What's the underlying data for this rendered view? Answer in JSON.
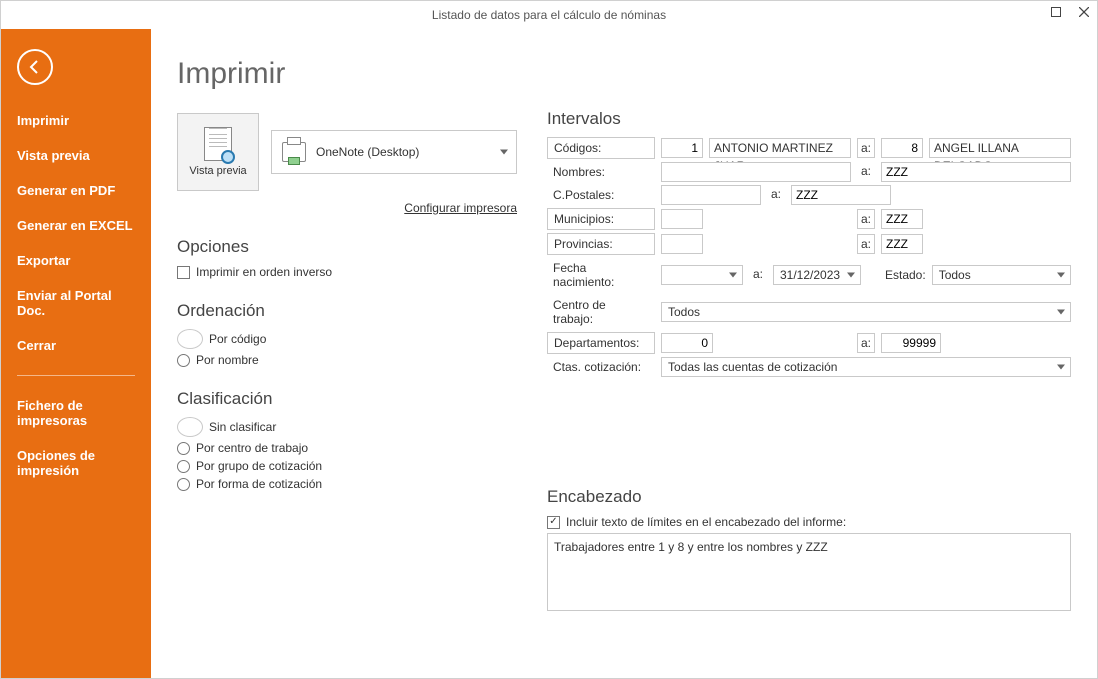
{
  "window": {
    "title": "Listado de datos para el cálculo de nóminas"
  },
  "sidebar": {
    "items": [
      "Imprimir",
      "Vista previa",
      "Generar en PDF",
      "Generar en EXCEL",
      "Exportar",
      "Enviar al Portal Doc.",
      "Cerrar"
    ],
    "items2": [
      "Fichero de impresoras",
      "Opciones de impresión"
    ]
  },
  "page": {
    "title": "Imprimir",
    "preview_label": "Vista previa",
    "printer_name": "OneNote (Desktop)",
    "config_printer": "Configurar impresora"
  },
  "opciones": {
    "section": "Opciones",
    "reverse": "Imprimir en orden inverso"
  },
  "ordenacion": {
    "section": "Ordenación",
    "por_codigo": "Por código",
    "por_nombre": "Por nombre"
  },
  "clasificacion": {
    "section": "Clasificación",
    "sin": "Sin clasificar",
    "centro": "Por centro de trabajo",
    "grupo": "Por grupo de cotización",
    "forma": "Por forma de cotización"
  },
  "intervalos": {
    "section": "Intervalos",
    "a": "a:",
    "codigos_label": "Códigos:",
    "codigos_from": "1",
    "codigos_from_name": "ANTONIO MARTINEZ JUAR",
    "codigos_to": "8",
    "codigos_to_name": "ANGEL ILLANA DELGADO",
    "nombres_label": "Nombres:",
    "nombres_from": "",
    "nombres_to": "ZZZ",
    "cpostales_label": "C.Postales:",
    "cpostales_from": "",
    "cpostales_to": "ZZZ",
    "municipios_label": "Municipios:",
    "municipios_from": "",
    "municipios_to": "ZZZ",
    "provincias_label": "Provincias:",
    "provincias_from": "",
    "provincias_to": "ZZZ",
    "fecha_label": "Fecha nacimiento:",
    "fecha_from": "",
    "fecha_to": "31/12/2023",
    "estado_label": "Estado:",
    "estado_value": "Todos",
    "centro_label": "Centro de trabajo:",
    "centro_value": "Todos",
    "dept_label": "Departamentos:",
    "dept_from": "0",
    "dept_to": "99999",
    "ctas_label": "Ctas. cotización:",
    "ctas_value": "Todas las cuentas de cotización"
  },
  "encabezado": {
    "section": "Encabezado",
    "chk_label": "Incluir texto de límites en el encabezado del informe:",
    "text": "Trabajadores entre 1 y 8 y entre los nombres  y ZZZ"
  }
}
